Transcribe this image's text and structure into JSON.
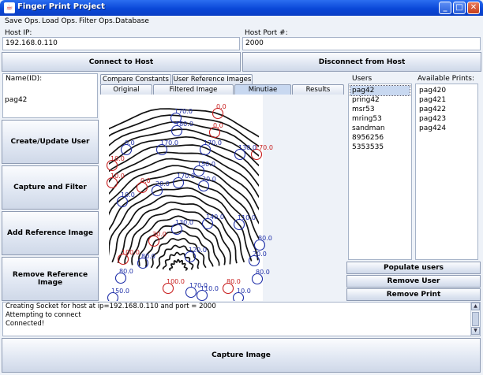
{
  "window": {
    "title": "Finger Print Project"
  },
  "menu": [
    "Save Ops.",
    "Load Ops.",
    "Filter Ops.",
    "Database"
  ],
  "host": {
    "ip_label": "Host IP:",
    "ip_value": "192.168.0.110",
    "port_label": "Host Port #:",
    "port_value": "2000"
  },
  "buttons": {
    "connect": "Connect to Host",
    "disconnect": "Disconnect from Host",
    "create_update": "Create/Update User",
    "capture_filter": "Capture and Filter",
    "add_reference": "Add Reference Image",
    "remove_reference": "Remove Reference Image",
    "populate_users": "Populate users",
    "remove_user": "Remove User",
    "remove_print": "Remove Print",
    "capture_image": "Capture Image"
  },
  "name": {
    "label": "Name(ID):",
    "value": "pag42"
  },
  "tabs_top": [
    "Compare Constants",
    "User Reference Images"
  ],
  "tabs_bottom": [
    "Original",
    "Filtered Image",
    "Minutiae",
    "Results"
  ],
  "active_tab": "Minutiae",
  "users": {
    "title": "Users",
    "items": [
      "pag42",
      "pring42",
      "msr53",
      "mring53",
      "sandman",
      "8956256",
      "5353535"
    ],
    "selected": "pag42"
  },
  "prints": {
    "title": "Available Prints:",
    "items": [
      "pag420",
      "pag421",
      "pag422",
      "pag423",
      "pag424"
    ]
  },
  "console": [
    "Creating Socket for host at ip=192.168.0.110 and port = 2000",
    "Attempting to connect",
    "Connected!"
  ],
  "minutiae": [
    {
      "a": "0.0",
      "c": "#c81e1e"
    },
    {
      "a": "170.0",
      "c": "#1e2ea8"
    },
    {
      "a": "180.0",
      "c": "#1e2ea8"
    },
    {
      "a": "0.0",
      "c": "#c81e1e"
    },
    {
      "a": "0.0",
      "c": "#1e2ea8"
    },
    {
      "a": "170.0",
      "c": "#1e2ea8"
    },
    {
      "a": "170.0",
      "c": "#1e2ea8"
    },
    {
      "a": "170.0",
      "c": "#c81e1e"
    },
    {
      "a": "130.0",
      "c": "#1e2ea8"
    },
    {
      "a": "10.0",
      "c": "#c81e1e"
    },
    {
      "a": "150.0",
      "c": "#1e2ea8"
    },
    {
      "a": "10.0",
      "c": "#c81e1e"
    },
    {
      "a": "0.0",
      "c": "#c81e1e"
    },
    {
      "a": "20.0",
      "c": "#1e2ea8"
    },
    {
      "a": "170.0",
      "c": "#1e2ea8"
    },
    {
      "a": "10.0",
      "c": "#1e2ea8"
    },
    {
      "a": "20.0",
      "c": "#1e2ea8"
    },
    {
      "a": "130.0",
      "c": "#1e2ea8"
    },
    {
      "a": "140.0",
      "c": "#1e2ea8"
    },
    {
      "a": "110.0",
      "c": "#1e2ea8"
    },
    {
      "a": "30.0",
      "c": "#c81e1e"
    },
    {
      "a": "80.0",
      "c": "#1e2ea8"
    },
    {
      "a": "100.0",
      "c": "#c81e1e"
    },
    {
      "a": "80.0",
      "c": "#1e2ea8"
    },
    {
      "a": "120.0",
      "c": "#1e2ea8"
    },
    {
      "a": "20.0",
      "c": "#1e2ea8"
    },
    {
      "a": "80.0",
      "c": "#1e2ea8"
    },
    {
      "a": "100.0",
      "c": "#c81e1e"
    },
    {
      "a": "170.0",
      "c": "#1e2ea8"
    },
    {
      "a": "80.0",
      "c": "#c81e1e"
    },
    {
      "a": "80.0",
      "c": "#1e2ea8"
    },
    {
      "a": "110.0",
      "c": "#1e2ea8"
    },
    {
      "a": "10.0",
      "c": "#1e2ea8"
    },
    {
      "a": "150.0",
      "c": "#1e2ea8"
    }
  ]
}
